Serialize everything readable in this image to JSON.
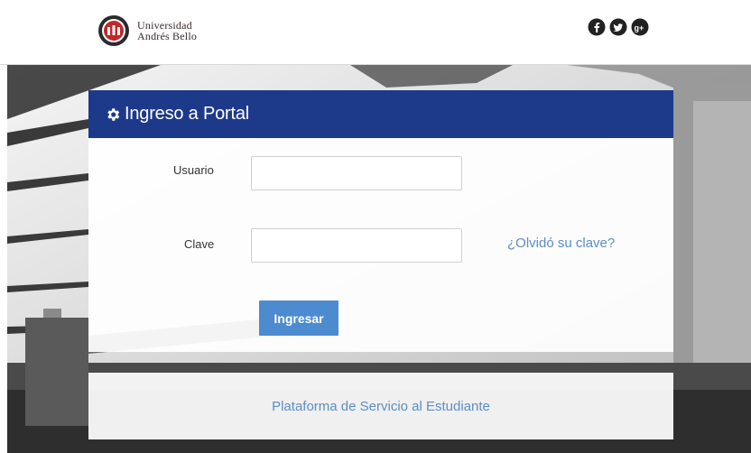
{
  "header": {
    "logo": {
      "line1": "Universidad",
      "line2": "Andrés Bello"
    },
    "social": [
      "facebook-icon",
      "twitter-icon",
      "google-plus-icon"
    ]
  },
  "login": {
    "title": "Ingreso a Portal",
    "username_label": "Usuario",
    "username_value": "",
    "password_label": "Clave",
    "password_value": "",
    "forgot_label": "¿Olvidó su clave?",
    "submit_label": "Ingresar"
  },
  "footer": {
    "link_label": "Plataforma de Servicio al Estudiante"
  },
  "colors": {
    "panel_header": "#1d3a8a",
    "button": "#4d8bd0",
    "link": "#5b8ec4"
  }
}
